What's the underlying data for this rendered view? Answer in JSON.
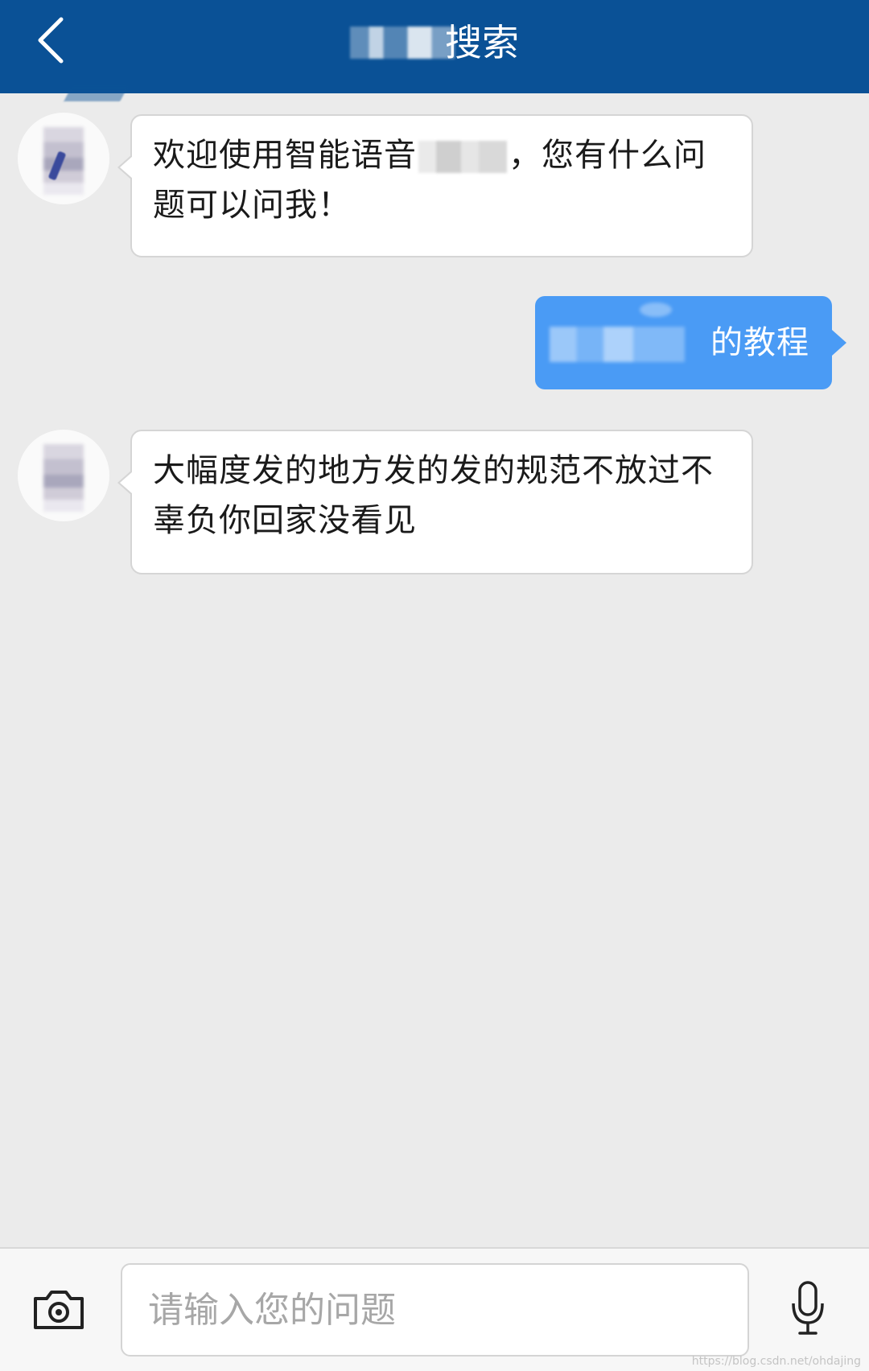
{
  "header": {
    "title_visible": "搜索",
    "back_icon": "chevron-left-icon",
    "background": "#0a5196"
  },
  "messages": [
    {
      "sender": "bot",
      "text_part1": "欢迎使用智能语音",
      "text_part2": "，您有什么问题可以问我！"
    },
    {
      "sender": "user",
      "text_visible": "的教程",
      "color": "#4a9bf5"
    },
    {
      "sender": "bot",
      "text": "大幅度发的地方发的发的规范不放过不辜负你回家没看见"
    }
  ],
  "input": {
    "placeholder": "请输入您的问题",
    "camera_icon": "camera-icon",
    "mic_icon": "microphone-icon"
  },
  "watermark": "https://blog.csdn.net/ohdajing"
}
